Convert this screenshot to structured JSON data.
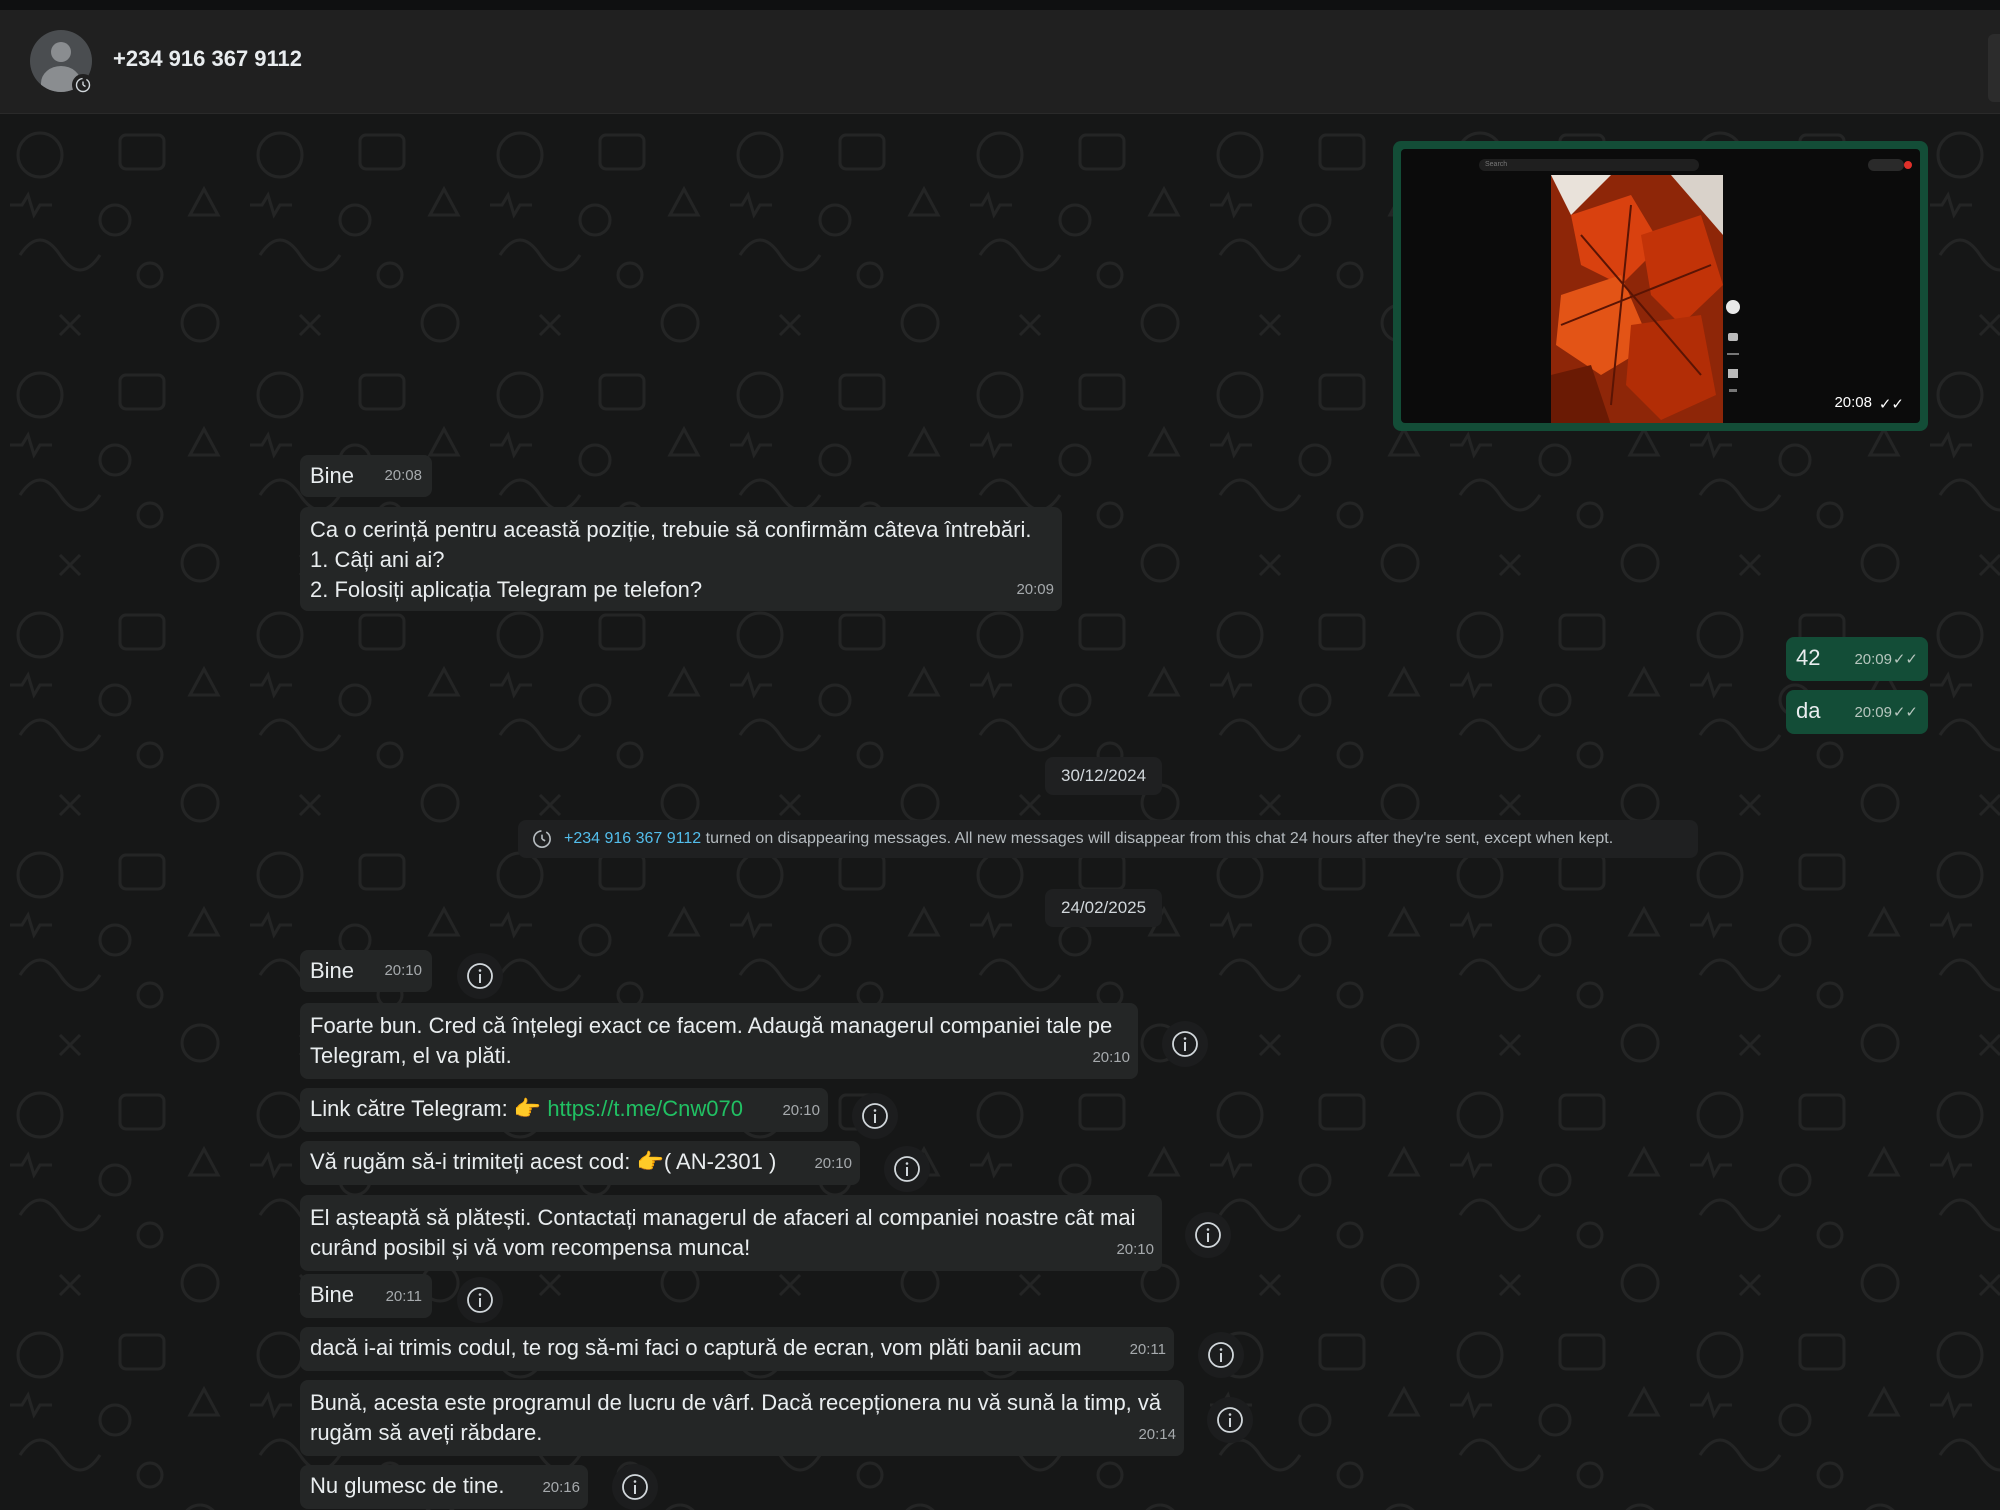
{
  "header": {
    "contact": "+234 916 367 9112"
  },
  "media": {
    "search_placeholder": "Search",
    "time": "20:08",
    "ticks": "✓✓"
  },
  "messages": [
    {
      "id": "m1",
      "text": "Bine",
      "time": "20:08"
    },
    {
      "id": "m2",
      "lines": [
        "Ca o cerință pentru această poziție, trebuie să confirmăm câteva întrebări.",
        "1. Câți ani ai?",
        "2. Folosiți aplicația Telegram pe telefon?"
      ],
      "time": "20:09"
    },
    {
      "id": "o1",
      "text": "42",
      "time": "20:09",
      "ticks": "✓✓"
    },
    {
      "id": "o2",
      "text": "da",
      "time": "20:09",
      "ticks": "✓✓"
    },
    {
      "id": "m3",
      "text": "Bine",
      "time": "20:10"
    },
    {
      "id": "m4",
      "lines": [
        "Foarte bun. Cred că înțelegi exact ce facem. Adaugă managerul companiei tale pe",
        "Telegram, el va plăti."
      ],
      "time": "20:10"
    },
    {
      "id": "m5",
      "prefix": "Link către Telegram: 👉 ",
      "link": "https://t.me/Cnw070",
      "time": "20:10"
    },
    {
      "id": "m6",
      "text": "Vă rugăm să-i trimiteți acest cod: 👉( AN-2301 )",
      "time": "20:10"
    },
    {
      "id": "m7",
      "lines": [
        "El așteaptă să plătești. Contactați managerul de afaceri al companiei noastre cât mai",
        "curând posibil și vă vom recompensa munca!"
      ],
      "time": "20:10"
    },
    {
      "id": "m8",
      "text": "Bine",
      "time": "20:11"
    },
    {
      "id": "m9",
      "text": "dacă i-ai trimis codul, te rog să-mi faci o captură de ecran, vom plăti banii acum",
      "time": "20:11"
    },
    {
      "id": "m10",
      "lines": [
        "Bună, acesta este programul de lucru de vârf. Dacă recepționera nu vă sună la timp, vă",
        "rugăm să aveți răbdare."
      ],
      "time": "20:14"
    },
    {
      "id": "m11",
      "text": "Nu glumesc de tine.",
      "time": "20:16"
    }
  ],
  "dates": {
    "d1": "30/12/2024",
    "d2": "24/02/2025"
  },
  "system": {
    "name": "+234 916 367 9112",
    "text": " turned on disappearing messages. All new messages will disappear from this chat 24 hours after they're sent, except when kept."
  },
  "colors": {
    "incoming": "#242626",
    "outgoing": "#134d37",
    "link": "#21c063",
    "system_name": "#53bdeb"
  }
}
